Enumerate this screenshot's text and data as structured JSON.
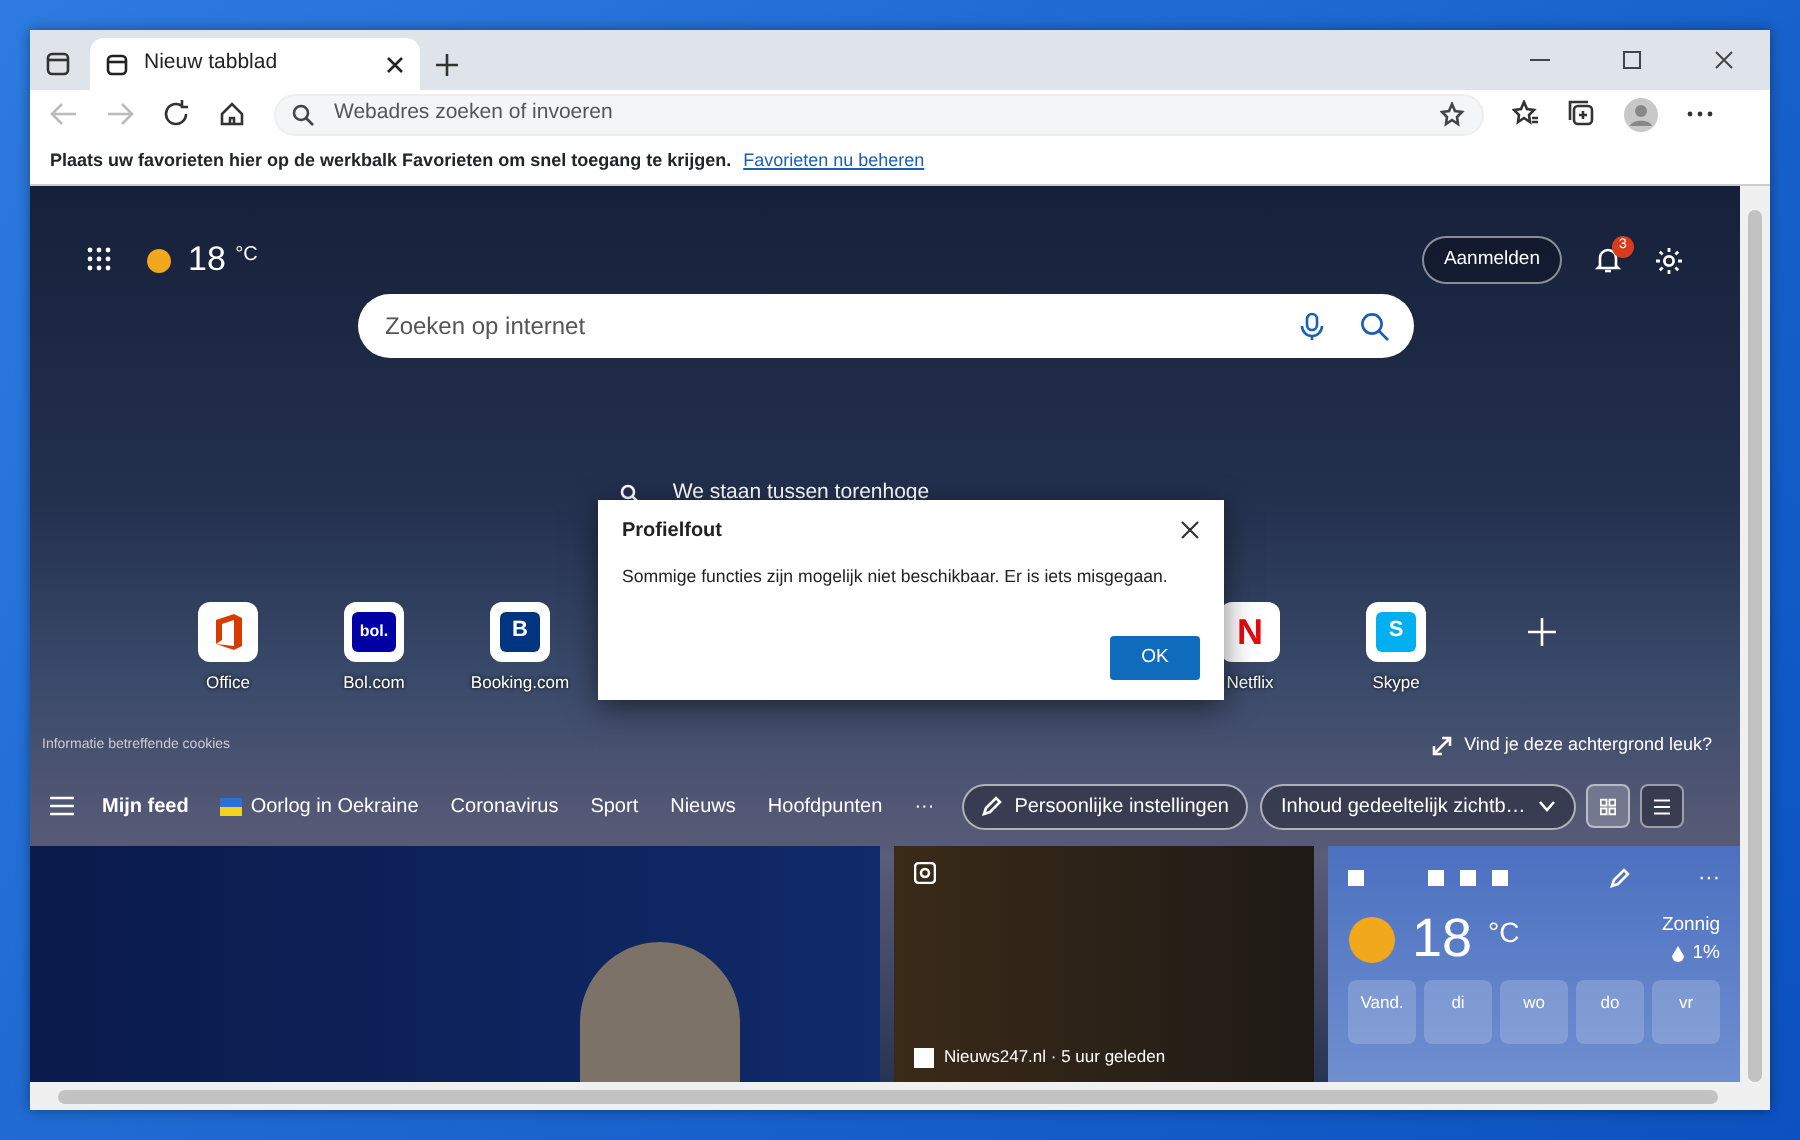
{
  "window": {
    "tabs": [
      {
        "title": "Nieuw tabblad",
        "selected": true
      }
    ]
  },
  "address_bar": {
    "placeholder": "Webadres zoeken of invoeren"
  },
  "favorites_bar": {
    "text": "Plaats uw favorieten hier op de werkbalk Favorieten om snel toegang te krijgen.",
    "link": "Favorieten nu beheren"
  },
  "header": {
    "temperature": "18",
    "unit": "°C",
    "signin": "Aanmelden",
    "notification_count": "3"
  },
  "search": {
    "placeholder": "Zoeken op internet"
  },
  "background_caption": "We staan tussen torenhoge",
  "quick_links": [
    {
      "label": "Office",
      "kind": "office"
    },
    {
      "label": "Bol.com",
      "kind": "text",
      "logo": "bol.",
      "color": "#0000a4"
    },
    {
      "label": "Booking.com",
      "kind": "text",
      "logo": "B",
      "color": "#003580"
    },
    {
      "label": "Netflix",
      "kind": "text",
      "logo": "N",
      "color": "#e50914"
    },
    {
      "label": "Skype",
      "kind": "text",
      "logo": "S",
      "color": "#00aff0"
    },
    {
      "kind": "add"
    }
  ],
  "cookie_note": "Informatie betreffende cookies",
  "background_prompt": "Vind je deze achtergrond leuk?",
  "feed_nav": {
    "items": [
      {
        "label": "Mijn feed",
        "selected": true,
        "kind": "plain"
      },
      {
        "label": "Oorlog in Oekraine",
        "selected": false,
        "kind": "flag"
      },
      {
        "label": "Coronavirus",
        "selected": false,
        "kind": "plain"
      },
      {
        "label": "Sport",
        "selected": false,
        "kind": "plain"
      },
      {
        "label": "Nieuws",
        "selected": false,
        "kind": "plain"
      },
      {
        "label": "Hoofdpunten",
        "selected": false,
        "kind": "plain"
      }
    ],
    "more": "···",
    "personalize": "Persoonlijke instellingen",
    "content_select": "Inhoud gedeeltelijk zichtb…"
  },
  "news_card": {
    "source": "Nieuws247.nl · 5 uur geleden"
  },
  "weather_card": {
    "temperature": "18",
    "unit": "°C",
    "condition": "Zonnig",
    "precipitation": "1%",
    "more": "···",
    "days": [
      "Vand.",
      "di",
      "wo",
      "do",
      "vr"
    ]
  },
  "dialog": {
    "title": "Profielfout",
    "message": "Sommige functies zijn mogelijk niet beschikbaar. Er is iets misgegaan.",
    "button": "OK"
  }
}
